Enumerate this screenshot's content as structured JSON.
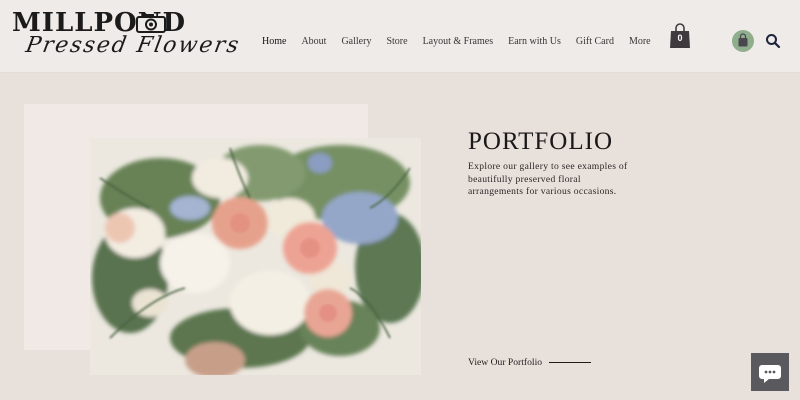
{
  "brand": {
    "name_top": "MILLPOND",
    "name_bottom": "Pressed Flowers"
  },
  "nav": {
    "items": [
      "Home",
      "About",
      "Gallery",
      "Store",
      "Layout & Frames",
      "Earn with Us",
      "Gift Card",
      "More"
    ],
    "active": "Home"
  },
  "cart": {
    "count": "0"
  },
  "icons": {
    "cart": "shopping-bag-icon",
    "shop": "shopping-bag-icon",
    "search": "search-icon",
    "chat": "chat-bubble-icon",
    "logo": "camera-icon"
  },
  "hero": {
    "title": "PORTFOLIO",
    "description": "Explore our gallery to see examples of beautifully preserved floral arrangements for various occasions.",
    "link_label": "View Our Portfolio"
  },
  "colors": {
    "background": "#e8e0db",
    "header": "#efebe8",
    "accent_green": "#8fae8e",
    "cart_dark": "#3e3a3e",
    "chat_button": "#5a5a5e"
  }
}
